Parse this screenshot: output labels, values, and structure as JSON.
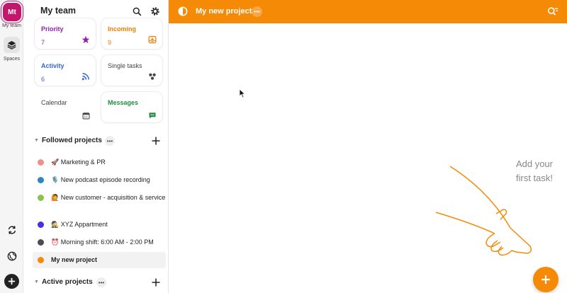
{
  "rail": {
    "team_initials": "Mt",
    "team_label": "My team",
    "spaces_label": "Spaces",
    "icons": [
      "layers-icon",
      "sync-icon",
      "globe-icon",
      "plus-icon"
    ]
  },
  "sidebar": {
    "title": "My team",
    "cards": [
      {
        "label": "Priority",
        "count": "7",
        "color": "#8e24aa",
        "icon": "star-icon"
      },
      {
        "label": "Incoming",
        "count": "9",
        "color": "#ef7d00",
        "icon": "inbox-icon"
      },
      {
        "label": "Activity",
        "count": "6",
        "color": "#3367d6",
        "icon": "rss-icon"
      },
      {
        "label": "Single tasks",
        "count": "",
        "color": "#444444",
        "icon": "cluster-icon"
      },
      {
        "label": "Calendar",
        "count": "",
        "color": "#444444",
        "icon": "calendar-icon"
      },
      {
        "label": "Messages",
        "count": "",
        "color": "#1e8e3e",
        "icon": "chat-icon"
      }
    ],
    "followed_header": "Followed projects",
    "followed": [
      {
        "label": "🚀 Marketing & PR",
        "color": "#f0908a"
      },
      {
        "label": "🎙️ New podcast episode recording",
        "color": "#2e86c1"
      },
      {
        "label": "🙋 New customer - acquisition & service",
        "color": "#8bc34a"
      },
      {
        "label": "🕵️ XYZ Appartment",
        "color": "#4a2fe0"
      },
      {
        "label": "⏰ Morning shift: 6:00 AM - 2:00 PM",
        "color": "#4a4a5a"
      },
      {
        "label": "My new project",
        "color": "#f58a07"
      }
    ],
    "active_header": "Active projects"
  },
  "header": {
    "title": "My new project",
    "accent": "#f58a07"
  },
  "main": {
    "empty_line1": "Add your",
    "empty_line2": "first task!"
  }
}
